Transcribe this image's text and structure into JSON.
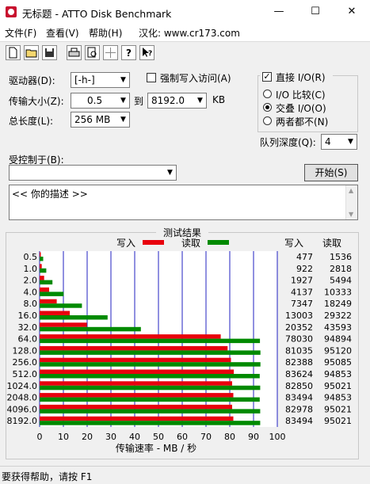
{
  "window": {
    "title": "无标题 - ATTO Disk Benchmark",
    "minimize": "—",
    "maximize": "☐",
    "close": "✕"
  },
  "menu": {
    "items": [
      "文件(F)",
      "查看(V)",
      "帮助(H)",
      "汉化: www.cr173.com"
    ]
  },
  "toolbar": {
    "icons": [
      "new-file-icon",
      "open-folder-icon",
      "save-icon",
      "print-icon",
      "print-preview-icon",
      "move-icon",
      "help-icon",
      "context-help-icon"
    ]
  },
  "settings": {
    "drive_label": "驱动器(D):",
    "drive_value": "[-h-]",
    "force_write_label": "强制写入访问(A)",
    "direct_io_label": "直接 I/O(R)",
    "direct_io_checked": true,
    "transfer_size_label": "传输大小(Z):",
    "transfer_from": "0.5",
    "to_label": "到",
    "transfer_to": "8192.0",
    "kb_label": "KB",
    "total_length_label": "总长度(L):",
    "total_length_value": "256 MB",
    "io_compare_label": "I/O 比较(C)",
    "overlapped_io_label": "交叠 I/O(O)",
    "neither_label": "两者都不(N)",
    "queue_depth_label": "队列深度(Q):",
    "queue_depth_value": "4",
    "controlled_by_label": "受控制于(B):",
    "controlled_by_value": "",
    "start_button": "开始(S)",
    "description": "<< 你的描述 >>"
  },
  "results": {
    "title": "测试结果",
    "write_legend": "写入",
    "read_legend": "读取",
    "write_header": "写入",
    "read_header": "读取",
    "write_color": "#e8000d",
    "read_color": "#008a00",
    "xlabel": "传输速率 - MB / 秒"
  },
  "chart_data": {
    "type": "bar",
    "orientation": "horizontal",
    "xlabel": "传输速率 - MB / 秒",
    "xlim": [
      0,
      100
    ],
    "xticks": [
      0,
      10,
      20,
      30,
      40,
      50,
      60,
      70,
      80,
      90,
      100
    ],
    "categories": [
      "0.5",
      "1.0",
      "2.0",
      "4.0",
      "8.0",
      "16.0",
      "32.0",
      "64.0",
      "128.0",
      "256.0",
      "512.0",
      "1024.0",
      "2048.0",
      "4096.0",
      "8192.0"
    ],
    "series": [
      {
        "name": "写入",
        "values": [
          0.5,
          0.9,
          1.9,
          4.0,
          7.2,
          12.7,
          19.9,
          76.2,
          79.1,
          80.5,
          81.7,
          81.0,
          81.5,
          81.0,
          81.5
        ]
      },
      {
        "name": "读取",
        "values": [
          1.5,
          2.8,
          5.4,
          10.1,
          17.8,
          28.6,
          42.6,
          92.7,
          92.9,
          92.9,
          92.6,
          92.8,
          92.6,
          92.8,
          92.8
        ]
      }
    ],
    "write_labels": [
      "477",
      "922",
      "1927",
      "4137",
      "7347",
      "13003",
      "20352",
      "78030",
      "81035",
      "82388",
      "83624",
      "82850",
      "83494",
      "82978",
      "83494"
    ],
    "read_labels": [
      "1536",
      "2818",
      "5494",
      "10333",
      "18249",
      "29322",
      "43593",
      "94894",
      "95120",
      "95085",
      "94853",
      "95021",
      "94853",
      "95021",
      "95021"
    ],
    "grid": true
  },
  "statusbar": {
    "text": "要获得帮助，请按 F1"
  }
}
